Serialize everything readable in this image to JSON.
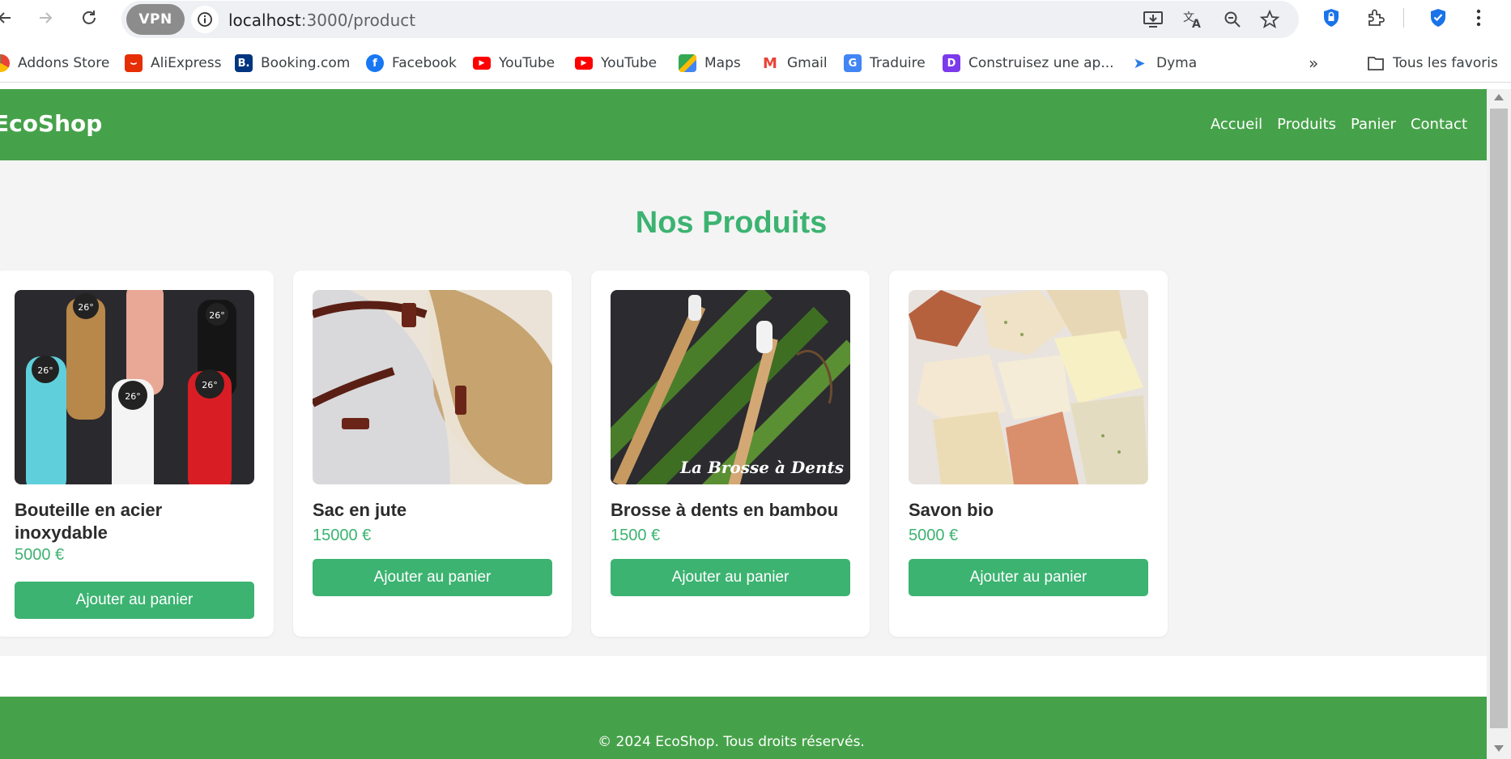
{
  "browser": {
    "url_host": "localhost",
    "url_path": ":3000/product",
    "vpn_label": "VPN",
    "bookmarks": [
      {
        "label": "Addons Store",
        "icon": "addons-store-icon",
        "color": "#ea4335"
      },
      {
        "label": "AliExpress",
        "icon": "aliexpress-icon",
        "color": "#e62e04"
      },
      {
        "label": "Booking.com",
        "icon": "booking-icon",
        "color": "#003580"
      },
      {
        "label": "Facebook",
        "icon": "facebook-icon",
        "color": "#1877f2"
      },
      {
        "label": "YouTube",
        "icon": "youtube-icon",
        "color": "#ff0000"
      },
      {
        "label": "YouTube",
        "icon": "youtube-icon",
        "color": "#ff0000"
      },
      {
        "label": "Maps",
        "icon": "maps-icon",
        "color": "#34a853"
      },
      {
        "label": "Gmail",
        "icon": "gmail-icon",
        "color": "#ea4335"
      },
      {
        "label": "Traduire",
        "icon": "translate-icon",
        "color": "#4285f4"
      },
      {
        "label": "Construisez une ap...",
        "icon": "app-builder-icon",
        "color": "#7c3aed"
      },
      {
        "label": "Dyma",
        "icon": "dyma-icon",
        "color": "#2a7de1"
      }
    ],
    "all_bookmarks_label": "Tous les favoris"
  },
  "site": {
    "logo": "EcoShop",
    "nav": [
      "Accueil",
      "Produits",
      "Panier",
      "Contact"
    ],
    "page_title": "Nos Produits",
    "products": [
      {
        "name": "Bouteille en acier inoxydable",
        "price": "5000 €",
        "button": "Ajouter au panier",
        "image": "bottles-image"
      },
      {
        "name": "Sac en jute",
        "price": "15000 €",
        "button": "Ajouter au panier",
        "image": "jute-bag-image"
      },
      {
        "name": "Brosse à dents en bambou",
        "price": "1500 €",
        "button": "Ajouter au panier",
        "image": "bamboo-toothbrush-image"
      },
      {
        "name": "Savon bio",
        "price": "5000 €",
        "button": "Ajouter au panier",
        "image": "soap-image"
      }
    ],
    "bottle_display": "26°",
    "toothbrush_caption": "La Brosse à Dents",
    "footer": "© 2024 EcoShop. Tous droits réservés."
  },
  "colors": {
    "brand_green": "#46a24a",
    "accent_green": "#3cb371",
    "page_bg": "#f4f4f4"
  }
}
